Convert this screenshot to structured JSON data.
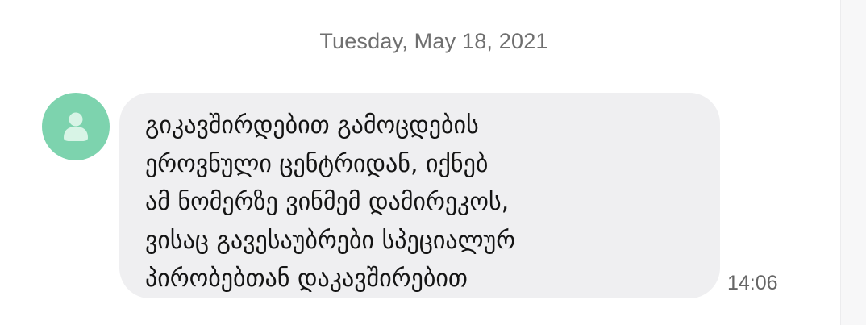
{
  "conversation": {
    "date_header": "Tuesday, May 18, 2021",
    "messages": [
      {
        "sender_avatar_icon": "person-icon",
        "text": "გიკავშირდებით გამოცდების\nეროვნული ცენტრიდან, იქნებ\nამ ნომერზე ვინმემ დამირეკოს,\nვისაც გავესაუბრები სპეციალურ\nპირობებთან დაკავშირებით",
        "time": "14:06"
      }
    ]
  },
  "colors": {
    "avatar_bg": "#7dd3ae",
    "bubble_bg": "#efeff1",
    "secondary_text": "#6f6f6f"
  }
}
